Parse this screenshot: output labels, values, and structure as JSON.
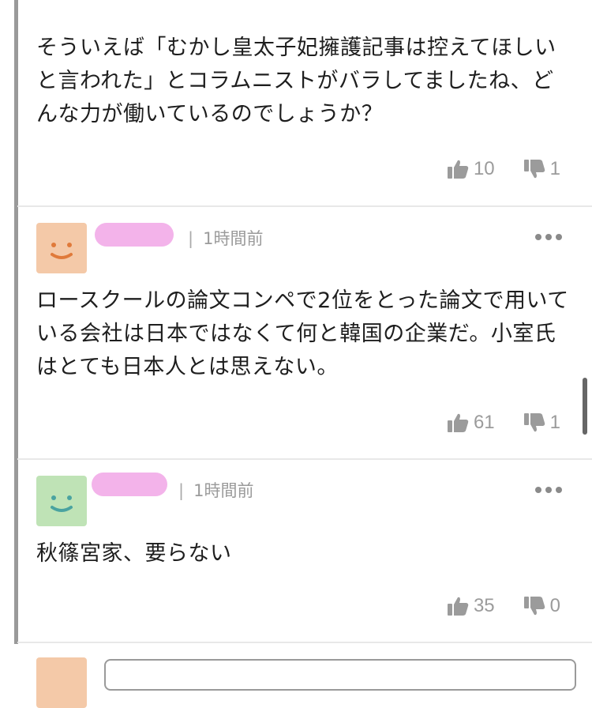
{
  "comments": [
    {
      "text": "そういえば「むかし皇太子妃擁護記事は控えてほしいと言われた」とコラムニストがバラしてましたね、どんな力が働いているのでしょうか？",
      "likes": "10",
      "dislikes": "1"
    },
    {
      "time": "1時間前",
      "avatar_color": "#f4c9a8",
      "face_color": "#e07a3a",
      "text": "ロースクールの論文コンペで2位をとった論文で用いている会社は日本ではなくて何と韓国の企業だ。小室氏はとても日本人とは思えない。",
      "likes": "61",
      "dislikes": "1"
    },
    {
      "time": "1時間前",
      "avatar_color": "#bfe3b6",
      "face_color": "#4aa3a0",
      "text": "秋篠宮家、要らない",
      "likes": "35",
      "dislikes": "0"
    }
  ],
  "separator": "|",
  "icons": {
    "like": "thumbs-up-icon",
    "dislike": "thumbs-down-icon",
    "more": "more-options-icon"
  },
  "colors": {
    "meta_gray": "#9b9b9b",
    "redaction_pink": "#f3b3ea"
  },
  "reply_avatar_color": "#f4c9a8"
}
